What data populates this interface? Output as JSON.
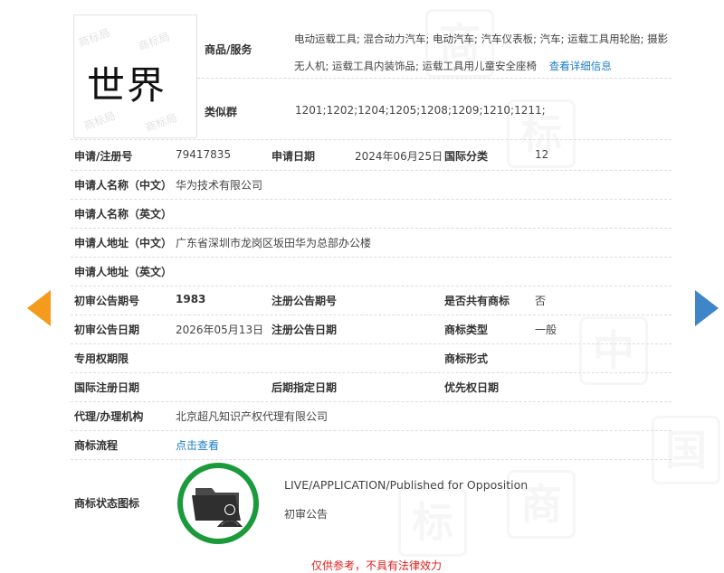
{
  "mark": {
    "name": "世界"
  },
  "goods": {
    "label": "商品/服务",
    "value": "电动运载工具; 混合动力汽车; 电动汽车; 汽车仪表板; 汽车; 运载工具用轮胎; 摄影无人机; 运载工具内装饰品; 运载工具用儿童安全座椅",
    "detail_link": "查看详细信息"
  },
  "similar_group": {
    "label": "类似群",
    "value": "1201;1202;1204;1205;1208;1209;1210;1211;"
  },
  "rows": {
    "reg_no": {
      "label": "申请/注册号",
      "value": "79417835"
    },
    "apply_date": {
      "label": "申请日期",
      "value": "2024年06月25日"
    },
    "intl_class": {
      "label": "国际分类",
      "value": "12"
    },
    "applicant_cn": {
      "label": "申请人名称（中文）",
      "value": "华为技术有限公司"
    },
    "applicant_en": {
      "label": "申请人名称（英文）",
      "value": ""
    },
    "address_cn": {
      "label": "申请人地址（中文）",
      "value": "广东省深圳市龙岗区坂田华为总部办公楼"
    },
    "address_en": {
      "label": "申请人地址（英文）",
      "value": ""
    },
    "prelim_no": {
      "label": "初审公告期号",
      "value": "1983"
    },
    "reg_pub_no": {
      "label": "注册公告期号",
      "value": ""
    },
    "shared": {
      "label": "是否共有商标",
      "value": "否"
    },
    "prelim_date": {
      "label": "初审公告日期",
      "value": "2026年05月13日"
    },
    "reg_pub_date": {
      "label": "注册公告日期",
      "value": ""
    },
    "mark_type": {
      "label": "商标类型",
      "value": "一般"
    },
    "exclusive_period": {
      "label": "专用权期限",
      "value": ""
    },
    "mark_form": {
      "label": "商标形式",
      "value": ""
    },
    "intl_reg_date": {
      "label": "国际注册日期",
      "value": ""
    },
    "later_designation": {
      "label": "后期指定日期",
      "value": ""
    },
    "priority_date": {
      "label": "优先权日期",
      "value": ""
    },
    "agent": {
      "label": "代理/办理机构",
      "value": "北京超凡知识产权代理有限公司"
    },
    "process": {
      "label": "商标流程",
      "value": "点击查看"
    }
  },
  "status": {
    "label": "商标状态图标",
    "en": "LIVE/APPLICATION/Published for Opposition",
    "cn": "初审公告",
    "ring_color": "#1b9a3c"
  },
  "footer": {
    "note": "仅供参考，不具有法律效力"
  },
  "nav": {
    "prev_icon": "arrow-left-icon",
    "next_icon": "arrow-right-icon",
    "prev_color": "#f49b1d",
    "next_color": "#3f86c9"
  }
}
